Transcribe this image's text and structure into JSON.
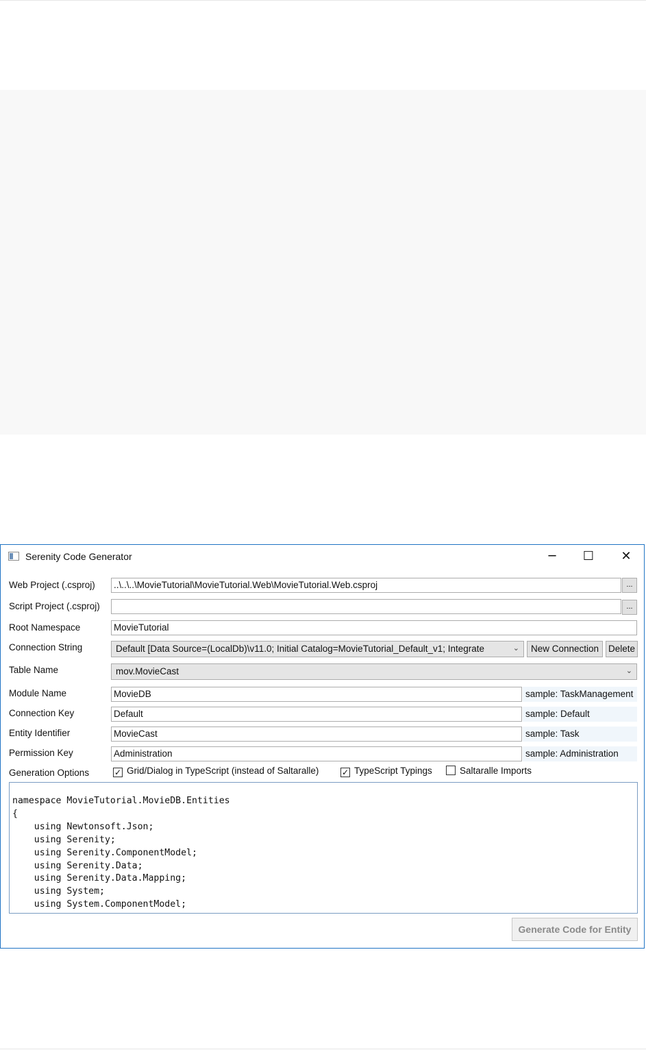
{
  "window": {
    "title": "Serenity Code Generator",
    "minimize_glyph": "─",
    "maximize_glyph": "☐",
    "close_glyph": "✕"
  },
  "form": {
    "web_project": {
      "label": "Web Project (.csproj)",
      "value": "..\\..\\..\\MovieTutorial\\MovieTutorial.Web\\MovieTutorial.Web.csproj",
      "browse_label": "..."
    },
    "script_project": {
      "label": "Script Project (.csproj)",
      "value": "",
      "browse_label": "..."
    },
    "root_namespace": {
      "label": "Root Namespace",
      "value": "MovieTutorial"
    },
    "connection_string": {
      "label": "Connection String",
      "value": "Default [Data Source=(LocalDb)\\v11.0; Initial Catalog=MovieTutorial_Default_v1; Integrate",
      "new_connection_label": "New Connection",
      "delete_label": "Delete"
    },
    "table_name": {
      "label": "Table Name",
      "value": "mov.MovieCast"
    },
    "module_name": {
      "label": "Module Name",
      "value": "MovieDB",
      "sample": "sample: TaskManagement"
    },
    "connection_key": {
      "label": "Connection Key",
      "value": "Default",
      "sample": "sample: Default"
    },
    "entity_identifier": {
      "label": "Entity Identifier",
      "value": "MovieCast",
      "sample": "sample: Task"
    },
    "permission_key": {
      "label": "Permission Key",
      "value": "Administration",
      "sample": "sample: Administration"
    },
    "generation_options": {
      "label": "Generation Options",
      "options": [
        {
          "label": "Grid/Dialog in TypeScript (instead of Saltaralle)",
          "checked": true,
          "mark": "✓"
        },
        {
          "label": "TypeScript Typings",
          "checked": true,
          "mark": "✓"
        },
        {
          "label": "Saltaralle Imports",
          "checked": false,
          "mark": ""
        }
      ]
    }
  },
  "code": {
    "lines": [
      "namespace MovieTutorial.MovieDB.Entities",
      "{",
      "    using Newtonsoft.Json;",
      "    using Serenity;",
      "    using Serenity.ComponentModel;",
      "    using Serenity.Data;",
      "    using Serenity.Data.Mapping;",
      "    using System;",
      "    using System.ComponentModel;"
    ]
  },
  "actions": {
    "generate_label": "Generate Code for Entity"
  },
  "icons": {
    "app": "app-window-icon",
    "dropdown": "chevron-down-icon",
    "dropdown_glyph": "⌄"
  }
}
